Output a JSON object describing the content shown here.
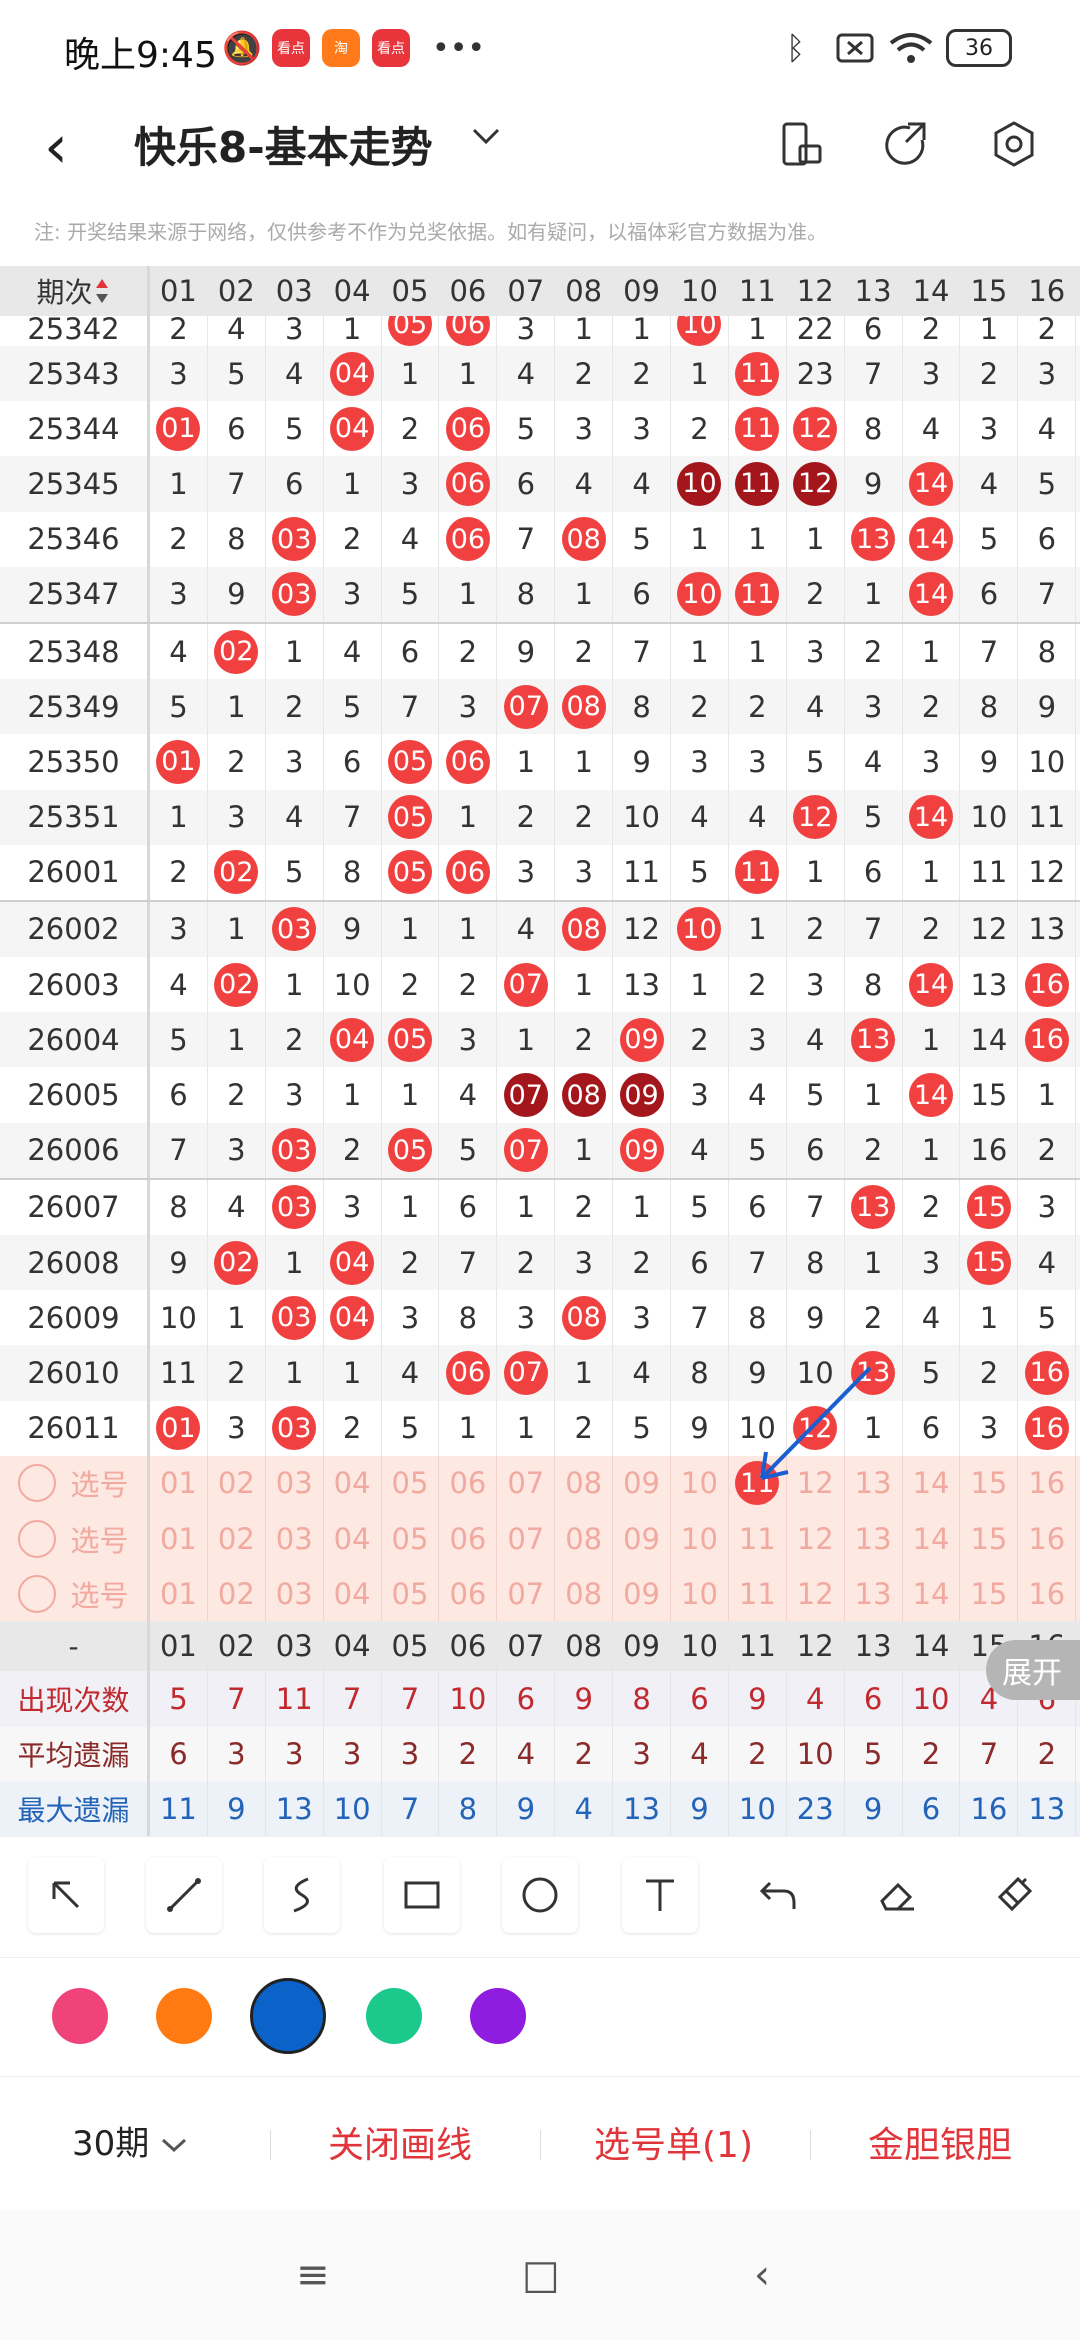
{
  "status_bar": {
    "time": "晚上9:45",
    "app_badges": [
      "看点",
      "淘",
      "看点"
    ],
    "more": "•••",
    "battery": "36"
  },
  "header": {
    "back": "‹",
    "title": "快乐8-基本走势",
    "dropdown": "⌄"
  },
  "notice": "注: 开奖结果来源于网络，仅供参考不作为兑奖依据。如有疑问，以福体彩官方数据为准。",
  "table": {
    "period_header": "期次",
    "columns": [
      "01",
      "02",
      "03",
      "04",
      "05",
      "06",
      "07",
      "08",
      "09",
      "10",
      "11",
      "12",
      "13",
      "14",
      "15",
      "16"
    ],
    "rows": [
      {
        "period": "25342",
        "cells": [
          "2",
          "4",
          "3",
          "1",
          "05",
          "06",
          "3",
          "1",
          "1",
          "10",
          "1",
          "22",
          "6",
          "2",
          "1",
          "2"
        ],
        "hits": [
          4,
          5,
          9
        ]
      },
      {
        "period": "25343",
        "cells": [
          "3",
          "5",
          "4",
          "04",
          "1",
          "1",
          "4",
          "2",
          "2",
          "1",
          "11",
          "23",
          "7",
          "3",
          "2",
          "3"
        ],
        "hits": [
          3,
          10
        ]
      },
      {
        "period": "25344",
        "cells": [
          "01",
          "6",
          "5",
          "04",
          "2",
          "06",
          "5",
          "3",
          "3",
          "2",
          "11",
          "12",
          "8",
          "4",
          "3",
          "4"
        ],
        "hits": [
          0,
          3,
          5,
          10,
          11
        ]
      },
      {
        "period": "25345",
        "cells": [
          "1",
          "7",
          "6",
          "1",
          "3",
          "06",
          "6",
          "4",
          "4",
          "10",
          "11",
          "12",
          "9",
          "14",
          "4",
          "5"
        ],
        "hits": [
          5,
          9,
          10,
          11,
          13
        ],
        "dark": [
          9,
          10,
          11
        ]
      },
      {
        "period": "25346",
        "cells": [
          "2",
          "8",
          "03",
          "2",
          "4",
          "06",
          "7",
          "08",
          "5",
          "1",
          "1",
          "1",
          "13",
          "14",
          "5",
          "6"
        ],
        "hits": [
          2,
          5,
          7,
          12,
          13
        ]
      },
      {
        "period": "25347",
        "cells": [
          "3",
          "9",
          "03",
          "3",
          "5",
          "1",
          "8",
          "1",
          "6",
          "10",
          "11",
          "2",
          "1",
          "14",
          "6",
          "7"
        ],
        "hits": [
          2,
          9,
          10,
          13
        ]
      },
      {
        "period": "25348",
        "cells": [
          "4",
          "02",
          "1",
          "4",
          "6",
          "2",
          "9",
          "2",
          "7",
          "1",
          "1",
          "3",
          "2",
          "1",
          "7",
          "8"
        ],
        "hits": [
          1
        ]
      },
      {
        "period": "25349",
        "cells": [
          "5",
          "1",
          "2",
          "5",
          "7",
          "3",
          "07",
          "08",
          "8",
          "2",
          "2",
          "4",
          "3",
          "2",
          "8",
          "9"
        ],
        "hits": [
          6,
          7
        ]
      },
      {
        "period": "25350",
        "cells": [
          "01",
          "2",
          "3",
          "6",
          "05",
          "06",
          "1",
          "1",
          "9",
          "3",
          "3",
          "5",
          "4",
          "3",
          "9",
          "10"
        ],
        "hits": [
          0,
          4,
          5
        ]
      },
      {
        "period": "25351",
        "cells": [
          "1",
          "3",
          "4",
          "7",
          "05",
          "1",
          "2",
          "2",
          "10",
          "4",
          "4",
          "12",
          "5",
          "14",
          "10",
          "11"
        ],
        "hits": [
          4,
          11,
          13
        ]
      },
      {
        "period": "26001",
        "cells": [
          "2",
          "02",
          "5",
          "8",
          "05",
          "06",
          "3",
          "3",
          "11",
          "5",
          "11",
          "1",
          "6",
          "1",
          "11",
          "12"
        ],
        "hits": [
          1,
          4,
          5,
          10
        ]
      },
      {
        "period": "26002",
        "cells": [
          "3",
          "1",
          "03",
          "9",
          "1",
          "1",
          "4",
          "08",
          "12",
          "10",
          "1",
          "2",
          "7",
          "2",
          "12",
          "13"
        ],
        "hits": [
          2,
          7,
          9
        ]
      },
      {
        "period": "26003",
        "cells": [
          "4",
          "02",
          "1",
          "10",
          "2",
          "2",
          "07",
          "1",
          "13",
          "1",
          "2",
          "3",
          "8",
          "14",
          "13",
          "16"
        ],
        "hits": [
          1,
          6,
          13,
          15
        ]
      },
      {
        "period": "26004",
        "cells": [
          "5",
          "1",
          "2",
          "04",
          "05",
          "3",
          "1",
          "2",
          "09",
          "2",
          "3",
          "4",
          "13",
          "1",
          "14",
          "16"
        ],
        "hits": [
          3,
          4,
          8,
          12,
          15
        ]
      },
      {
        "period": "26005",
        "cells": [
          "6",
          "2",
          "3",
          "1",
          "1",
          "4",
          "07",
          "08",
          "09",
          "3",
          "4",
          "5",
          "1",
          "14",
          "15",
          "1"
        ],
        "hits": [
          6,
          7,
          8,
          13
        ],
        "dark": [
          6,
          7,
          8
        ]
      },
      {
        "period": "26006",
        "cells": [
          "7",
          "3",
          "03",
          "2",
          "05",
          "5",
          "07",
          "1",
          "09",
          "4",
          "5",
          "6",
          "2",
          "1",
          "16",
          "2"
        ],
        "hits": [
          2,
          4,
          6,
          8
        ]
      },
      {
        "period": "26007",
        "cells": [
          "8",
          "4",
          "03",
          "3",
          "1",
          "6",
          "1",
          "2",
          "1",
          "5",
          "6",
          "7",
          "13",
          "2",
          "15",
          "3"
        ],
        "hits": [
          2,
          12,
          14
        ]
      },
      {
        "period": "26008",
        "cells": [
          "9",
          "02",
          "1",
          "04",
          "2",
          "7",
          "2",
          "3",
          "2",
          "6",
          "7",
          "8",
          "1",
          "3",
          "15",
          "4"
        ],
        "hits": [
          1,
          3,
          14
        ]
      },
      {
        "period": "26009",
        "cells": [
          "10",
          "1",
          "03",
          "04",
          "3",
          "8",
          "3",
          "08",
          "3",
          "7",
          "8",
          "9",
          "2",
          "4",
          "1",
          "5"
        ],
        "hits": [
          2,
          3,
          7
        ]
      },
      {
        "period": "26010",
        "cells": [
          "11",
          "2",
          "1",
          "1",
          "4",
          "06",
          "07",
          "1",
          "4",
          "8",
          "9",
          "10",
          "13",
          "5",
          "2",
          "16"
        ],
        "hits": [
          5,
          6,
          12,
          15
        ]
      },
      {
        "period": "26011",
        "cells": [
          "01",
          "3",
          "03",
          "2",
          "5",
          "1",
          "1",
          "2",
          "5",
          "9",
          "10",
          "12",
          "1",
          "6",
          "3",
          "16"
        ],
        "hits": [
          0,
          2,
          11,
          15
        ]
      }
    ],
    "pick_rows": [
      {
        "label": "选号",
        "selected": [
          10
        ]
      },
      {
        "label": "选号",
        "selected": []
      },
      {
        "label": "选号",
        "selected": []
      }
    ],
    "footer_label": "-",
    "stats": [
      {
        "label": "出现次数",
        "values": [
          "5",
          "7",
          "11",
          "7",
          "7",
          "10",
          "6",
          "9",
          "8",
          "6",
          "9",
          "4",
          "6",
          "10",
          "4",
          "6"
        ]
      },
      {
        "label": "平均遗漏",
        "values": [
          "6",
          "3",
          "3",
          "3",
          "3",
          "2",
          "4",
          "2",
          "3",
          "4",
          "2",
          "10",
          "5",
          "2",
          "7",
          "2"
        ]
      },
      {
        "label": "最大遗漏",
        "values": [
          "11",
          "9",
          "13",
          "10",
          "7",
          "8",
          "9",
          "4",
          "13",
          "9",
          "10",
          "23",
          "9",
          "6",
          "16",
          "13"
        ]
      }
    ]
  },
  "expand_label": "展开",
  "tools": [
    "arrow-tool",
    "line-tool",
    "curve-tool",
    "rect-tool",
    "circle-tool",
    "text-tool",
    "undo-tool",
    "eraser-tool",
    "clear-tool"
  ],
  "colors": [
    "#f0437a",
    "#ff7a12",
    "#0b63c9",
    "#1cc98d",
    "#8f1de0"
  ],
  "bottom": {
    "periods": "30期",
    "close_drawing": "关闭画线",
    "selection": "选号单(1)",
    "golden": "金胆银胆"
  },
  "navbar": {
    "menu": "≡",
    "home": "□",
    "back": "‹"
  }
}
